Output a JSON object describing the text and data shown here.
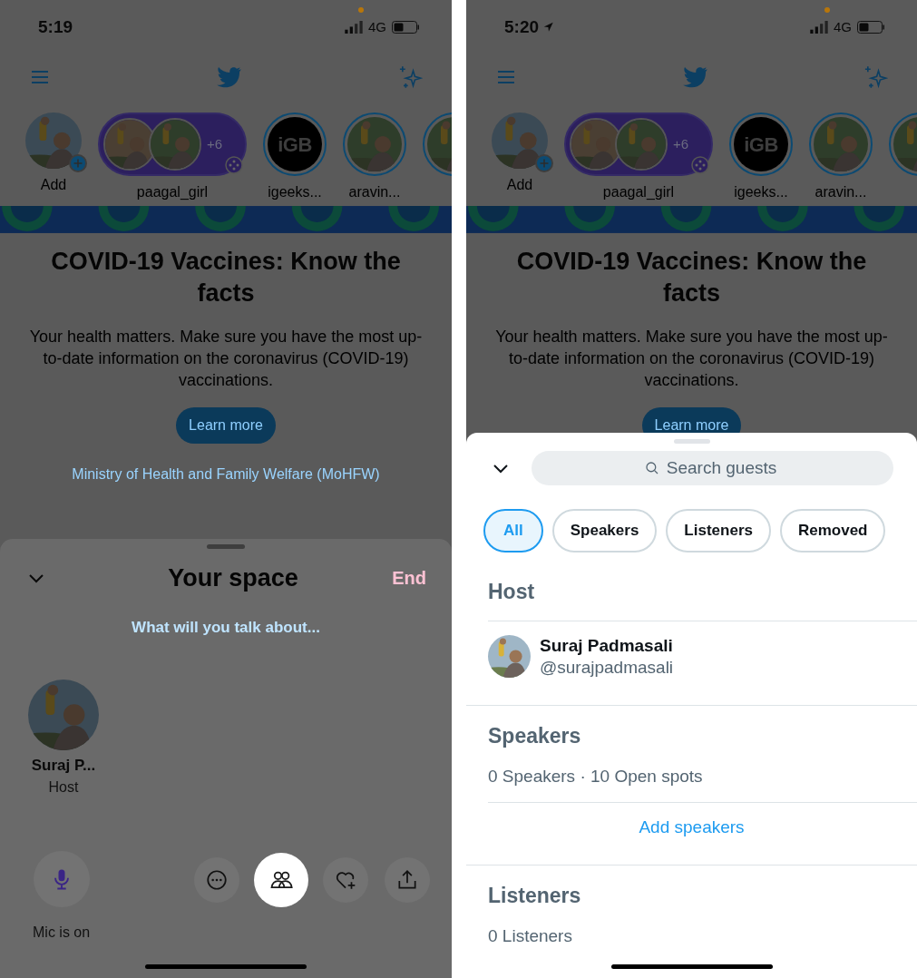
{
  "screens": [
    {
      "status_bar": {
        "time": "5:19",
        "location_arrow": false,
        "network": "4G"
      },
      "fleets": [
        {
          "label": "Add",
          "kind": "add"
        },
        {
          "label": "paagal_girl",
          "kind": "space",
          "count": "+6"
        },
        {
          "label": "igeeks...",
          "kind": "logo",
          "logo_text": "iGB"
        },
        {
          "label": "aravin...",
          "kind": "user"
        },
        {
          "kind": "user"
        }
      ],
      "banner": {
        "title": "COVID-19 Vaccines: Know the facts",
        "body": "Your health matters. Make sure you have the most up-to-date information on the coronavirus (COVID-19) vaccinations.",
        "button": "Learn more",
        "source": "Ministry of Health and Family Welfare (MoHFW)"
      },
      "sheet": {
        "kind": "space",
        "title": "Your space",
        "end": "End",
        "topic_placeholder": "What will you talk about...",
        "host": {
          "name": "Suraj P...",
          "role": "Host"
        },
        "mic": {
          "label": "Mic is on"
        },
        "actions": [
          {
            "kind": "more",
            "selected": false
          },
          {
            "kind": "people",
            "selected": true
          },
          {
            "kind": "heart-plus",
            "selected": false
          },
          {
            "kind": "share",
            "selected": false
          }
        ]
      }
    },
    {
      "status_bar": {
        "time": "5:20",
        "location_arrow": true,
        "network": "4G"
      },
      "fleets": [
        {
          "label": "Add",
          "kind": "add"
        },
        {
          "label": "paagal_girl",
          "kind": "space",
          "count": "+6"
        },
        {
          "label": "igeeks...",
          "kind": "logo",
          "logo_text": "iGB"
        },
        {
          "label": "aravin...",
          "kind": "user"
        },
        {
          "kind": "user"
        }
      ],
      "banner": {
        "title": "COVID-19 Vaccines: Know the facts",
        "body": "Your health matters. Make sure you have the most up-to-date information on the coronavirus (COVID-19) vaccinations.",
        "button": "Learn more"
      },
      "sheet": {
        "kind": "guests",
        "search": {
          "placeholder": "Search guests"
        },
        "filters": [
          {
            "label": "All",
            "selected": true
          },
          {
            "label": "Speakers",
            "selected": false
          },
          {
            "label": "Listeners",
            "selected": false
          },
          {
            "label": "Removed",
            "selected": false
          }
        ],
        "sections": [
          {
            "title": "Host",
            "members": [
              {
                "name": "Suraj Padmasali",
                "handle": "@surajpadmasali"
              }
            ]
          },
          {
            "title": "Speakers",
            "summary": "0 Speakers · 10 Open spots",
            "action": "Add speakers"
          },
          {
            "title": "Listeners",
            "summary": "0 Listeners"
          }
        ]
      }
    }
  ]
}
